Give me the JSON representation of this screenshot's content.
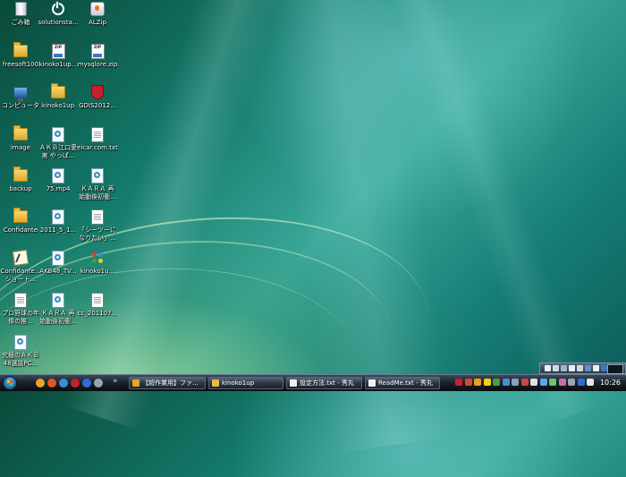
{
  "desktop": {
    "icons": [
      {
        "name": "recycle-bin-icon",
        "kind": "trash",
        "label": "ごみ箱",
        "label2": ""
      },
      {
        "name": "solutionsta-icon",
        "kind": "power",
        "label": "solutionsta...",
        "label2": ""
      },
      {
        "name": "alzip-icon",
        "kind": "alzip",
        "label": "ALZip",
        "label2": ""
      },
      {
        "name": "freesoft-folder-icon",
        "kind": "folder",
        "label": "freesoft100",
        "label2": ""
      },
      {
        "name": "kinoko-zip-icon",
        "kind": "zip",
        "label": "kinoko1up...",
        "label2": ""
      },
      {
        "name": "mysqlore-zip-icon",
        "kind": "zip",
        "label": "mysqlore.zip",
        "label2": ""
      },
      {
        "name": "computer-icon",
        "kind": "computer",
        "label": "コンピュータ",
        "label2": ""
      },
      {
        "name": "kinoko-folder-icon",
        "kind": "folder",
        "label": "kinoko1up",
        "label2": ""
      },
      {
        "name": "gdis-shield-icon",
        "kind": "shield",
        "label": "GDIS2012...",
        "label2": ""
      },
      {
        "name": "image-folder-icon",
        "kind": "folder",
        "label": "image",
        "label2": ""
      },
      {
        "name": "akb-media-icon",
        "kind": "media",
        "label": "ＡＫＢ江口愛",
        "label2": "実 やっぱ..."
      },
      {
        "name": "eicar-file-icon",
        "kind": "doc",
        "label": "eicar.com.txt",
        "label2": ""
      },
      {
        "name": "backup-folder-icon",
        "kind": "folder",
        "label": "backup",
        "label2": ""
      },
      {
        "name": "mp4-media-icon",
        "kind": "media",
        "label": "75.mp4",
        "label2": ""
      },
      {
        "name": "kara-media-icon",
        "kind": "media",
        "label": "ＫＡＲＡ 再",
        "label2": "始動後初衝..."
      },
      {
        "name": "confidante-folder-icon",
        "kind": "folder",
        "label": "Confidante",
        "label2": ""
      },
      {
        "name": "2011-media-icon",
        "kind": "media",
        "label": "2011_5_1...",
        "label2": ""
      },
      {
        "name": "cd-doc-icon",
        "kind": "doc",
        "label": "「シーツーに",
        "label2": "なりたい」..."
      },
      {
        "name": "confidante-shortcut-icon",
        "kind": "note",
        "label": "Confidante...",
        "label2": "ショート..."
      },
      {
        "name": "akb48-media-icon",
        "kind": "media",
        "label": "AKB48_TV...",
        "label2": ""
      },
      {
        "name": "kinoko-people-icon",
        "kind": "people",
        "label": "kinoko1u...",
        "label2": ""
      },
      {
        "name": "prog-doc-icon",
        "kind": "doc",
        "label": "プロ野球の年",
        "label2": "俸の推..."
      },
      {
        "name": "kara2-media-icon",
        "kind": "media",
        "label": "ＫＡＲＡ 再",
        "label2": "始動後初衝..."
      },
      {
        "name": "cc-doc-icon",
        "kind": "doc",
        "label": "cc_201107...",
        "label2": ""
      },
      {
        "name": "final-media-icon",
        "kind": "media",
        "label": "究極のＡＫＢ",
        "label2": "48選抜PC..."
      }
    ]
  },
  "taskbar": {
    "start_label": "Start",
    "quick_launch": [
      {
        "name": "chrome-quicklaunch-icon",
        "color": "#e9a526"
      },
      {
        "name": "firefox-quicklaunch-icon",
        "color": "#e4571e"
      },
      {
        "name": "media-quicklaunch-icon",
        "color": "#3a8fd6"
      },
      {
        "name": "red-quicklaunch-icon",
        "color": "#c8202a"
      },
      {
        "name": "blue-quicklaunch-icon",
        "color": "#2b6fd0"
      },
      {
        "name": "gray-quicklaunch-icon",
        "color": "#9aa5b0"
      }
    ],
    "chevron": "»",
    "tasks": [
      {
        "name": "task-chrome",
        "label": "【超作業用】ファ...",
        "color": "#e9a526"
      },
      {
        "name": "task-kinoko-folder",
        "label": "kinoko1up",
        "color": "#e8b940"
      },
      {
        "name": "task-settings-txt",
        "label": "設定方法.txt - 秀丸",
        "color": "#f0f0f0"
      },
      {
        "name": "task-readme-txt",
        "label": "ReadMe.txt - 秀丸",
        "color": "#f0f0f0"
      }
    ],
    "tray_icons": [
      "#c8202a",
      "#d34a2f",
      "#e5a11d",
      "#f1d21b",
      "#3fa048",
      "#4a8cd6",
      "#8aa2b8",
      "#c84747",
      "#e0e0e0",
      "#5aa7e3",
      "#6fc46f",
      "#d46aa3",
      "#9aa5b0",
      "#2b6fd0",
      "#e5e5e5"
    ],
    "clock": "10:26"
  },
  "sidebar_toolbar": {
    "icons": [
      "#e8eef2",
      "#cfd8e0",
      "#9fb7cc",
      "#e8eef2",
      "#cfd8e0",
      "#5f8fc4",
      "#e8eef2",
      "#3b78c2"
    ]
  }
}
